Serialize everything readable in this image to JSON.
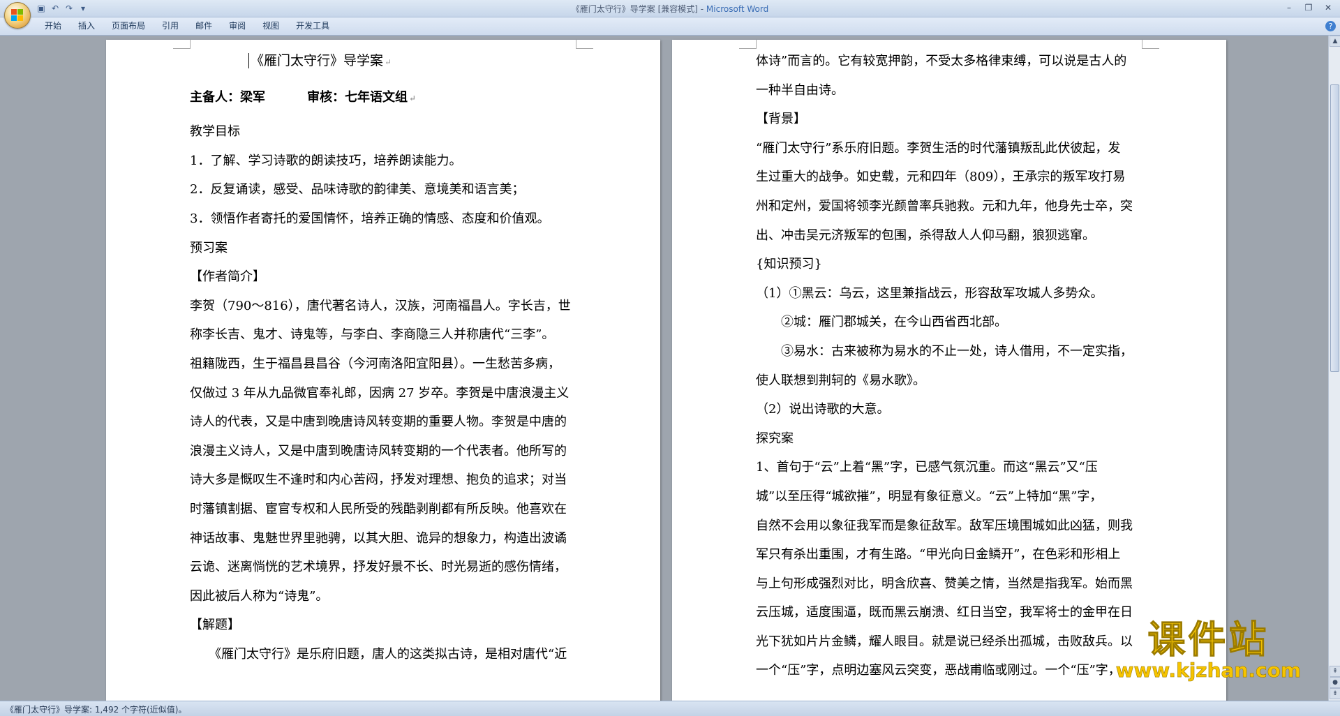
{
  "window": {
    "title_doc": "《雁门太守行》导学案 [兼容模式] - ",
    "title_app": "Microsoft Word"
  },
  "quick_access": {
    "icons": [
      "save-icon",
      "undo-icon",
      "redo-icon",
      "customize-icon"
    ]
  },
  "ribbon": {
    "tabs": [
      {
        "label": "开始"
      },
      {
        "label": "插入"
      },
      {
        "label": "页面布局"
      },
      {
        "label": "引用"
      },
      {
        "label": "邮件"
      },
      {
        "label": "审阅"
      },
      {
        "label": "视图"
      },
      {
        "label": "开发工具"
      }
    ]
  },
  "left_page": {
    "title": "《雁门太守行》导学案",
    "preparer": "主备人：梁军",
    "reviewer": "审核：七年语文组",
    "lines": [
      "教学目标",
      "1．了解、学习诗歌的朗读技巧，培养朗读能力。",
      "2．反复诵读，感受、品味诗歌的韵律美、意境美和语言美；",
      "3．领悟作者寄托的爱国情怀，培养正确的情感、态度和价值观。",
      "预习案",
      "【作者简介】",
      "李贺（790～816），唐代著名诗人，汉族，河南福昌人。字长吉，世",
      "称李长吉、鬼才、诗鬼等，与李白、李商隐三人并称唐代“三李”。",
      "祖籍陇西，生于福昌县昌谷（今河南洛阳宜阳县）。一生愁苦多病，",
      "仅做过 3 年从九品微官奉礼郎，因病 27 岁卒。李贺是中唐浪漫主义",
      "诗人的代表，又是中唐到晚唐诗风转变期的重要人物。李贺是中唐的",
      "浪漫主义诗人，又是中唐到晚唐诗风转变期的一个代表者。他所写的",
      "诗大多是慨叹生不逢时和内心苦闷，抒发对理想、抱负的追求；对当",
      "时藩镇割据、宦官专权和人民所受的残酷剥削都有所反映。他喜欢在",
      "神话故事、鬼魅世界里驰骋，以其大胆、诡异的想象力，构造出波谲",
      "云诡、迷离惝恍的艺术境界，抒发好景不长、时光易逝的感伤情绪，",
      "因此被后人称为“诗鬼”。",
      "【解题】",
      "　　《雁门太守行》是乐府旧题，唐人的这类拟古诗，是相对唐代“近"
    ]
  },
  "right_page": {
    "lines": [
      "体诗”而言的。它有较宽押韵，不受太多格律束缚，可以说是古人的",
      "一种半自由诗。",
      "【背景】",
      "“雁门太守行”系乐府旧题。李贺生活的时代藩镇叛乱此伏彼起，发",
      "生过重大的战争。如史载，元和四年（809），王承宗的叛军攻打易",
      "州和定州，爱国将领李光颜曾率兵驰救。元和九年，他身先士卒，突",
      "出、冲击吴元济叛军的包围，杀得敌人人仰马翻，狼狈逃窜。",
      "{知识预习}",
      "（1）①黑云：乌云，这里兼指战云，形容敌军攻城人多势众。",
      "　　②城：雁门郡城关，在今山西省西北部。",
      "　　③易水：古来被称为易水的不止一处，诗人借用，不一定实指，",
      "使人联想到荆轲的《易水歌》。",
      "（2）说出诗歌的大意。",
      "探究案",
      "1、首句于“云”上着“黑”字，已感气氛沉重。而这“黑云”又“压",
      "城”以至压得“城欲摧”，明显有象征意义。“云”上特加“黑”字，",
      "自然不会用以象征我军而是象征敌军。敌军压境围城如此凶猛，则我",
      "军只有杀出重围，才有生路。“甲光向日金鳞开”，在色彩和形相上",
      "与上句形成强烈对比，明含欣喜、赞美之情，当然是指我军。始而黑",
      "云压城，适度围逼，既而黑云崩溃、红日当空，我军将士的金甲在日",
      "光下犹如片片金鳞，耀人眼目。就是说已经杀出孤城，击败敌兵。以",
      "一个“压”字，点明边塞风云突变，恶战甫临或刚过。一个“压”字，"
    ]
  },
  "status": {
    "text": "《雁门太守行》导学案: 1,492 个字符(近似值)。"
  },
  "watermark": {
    "main": "课件站",
    "url": "www.kjzhan.com"
  }
}
